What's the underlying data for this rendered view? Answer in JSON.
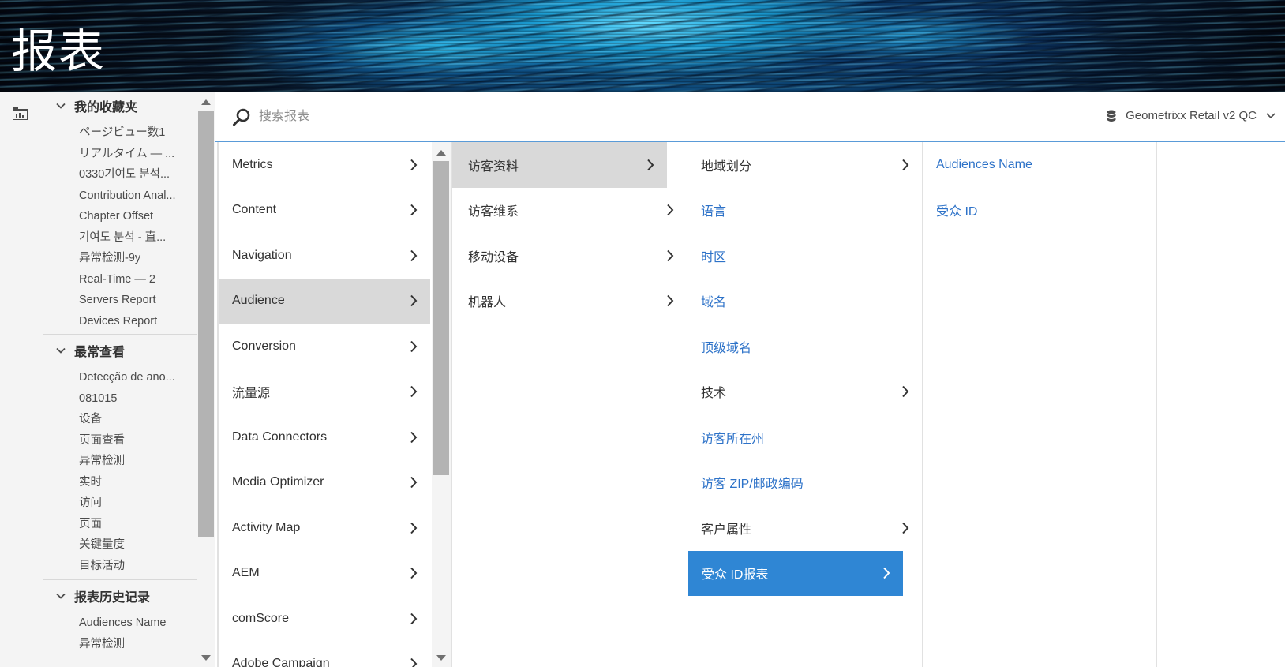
{
  "header": {
    "title": "报表"
  },
  "search": {
    "placeholder": "搜索报表",
    "value": ""
  },
  "report_suite": {
    "label": "Geometrixx Retail v2 QC"
  },
  "sidebar": {
    "favorites": {
      "title": "我的收藏夹",
      "items": [
        "ページビュー数1",
        "リアルタイム — ...",
        "0330기여도 분석...",
        "Contribution Anal...",
        "Chapter Offset",
        "기여도 분석 - 直...",
        "异常检测-9y",
        "Real-Time — 2",
        "Servers Report",
        "Devices Report"
      ]
    },
    "most_viewed": {
      "title": "最常查看",
      "items": [
        "Detecção de ano...",
        "081015",
        "设备",
        "页面查看",
        "异常检测",
        "实时",
        "访问",
        "页面",
        "关键量度",
        "目标活动"
      ]
    },
    "history": {
      "title": "报表历史记录",
      "items": [
        "Audiences Name",
        "异常检测"
      ]
    }
  },
  "columns": {
    "col1": [
      {
        "label": "Metrics",
        "has_children": true
      },
      {
        "label": "Content",
        "has_children": true
      },
      {
        "label": "Navigation",
        "has_children": true
      },
      {
        "label": "Audience",
        "has_children": true,
        "selected": true
      },
      {
        "label": "Conversion",
        "has_children": true
      },
      {
        "label": "流量源",
        "has_children": true
      },
      {
        "label": "Data Connectors",
        "has_children": true
      },
      {
        "label": "Media Optimizer",
        "has_children": true
      },
      {
        "label": "Activity Map",
        "has_children": true
      },
      {
        "label": "AEM",
        "has_children": true
      },
      {
        "label": "comScore",
        "has_children": true
      },
      {
        "label": "Adobe Campaign",
        "has_children": true
      }
    ],
    "col2": [
      {
        "label": "访客资料",
        "has_children": true,
        "selected": true
      },
      {
        "label": "访客维系",
        "has_children": true
      },
      {
        "label": "移动设备",
        "has_children": true
      },
      {
        "label": "机器人",
        "has_children": true
      }
    ],
    "col3": [
      {
        "label": "地域划分",
        "has_children": true
      },
      {
        "label": "语言",
        "link": true
      },
      {
        "label": "时区",
        "link": true
      },
      {
        "label": "域名",
        "link": true
      },
      {
        "label": "顶级域名",
        "link": true
      },
      {
        "label": "技术",
        "has_children": true
      },
      {
        "label": "访客所在州",
        "link": true
      },
      {
        "label": "访客 ZIP/邮政编码",
        "link": true
      },
      {
        "label": "客户属性",
        "has_children": true
      },
      {
        "label": "受众 ID报表",
        "has_children": true,
        "active": true
      }
    ],
    "col4": [
      {
        "label": "Audiences Name",
        "link": true
      },
      {
        "label": "受众 ID",
        "link": true
      }
    ]
  },
  "colors": {
    "accent": "#2f86d4",
    "link": "#2d72c8",
    "selected_bg": "#d9d9d9"
  }
}
